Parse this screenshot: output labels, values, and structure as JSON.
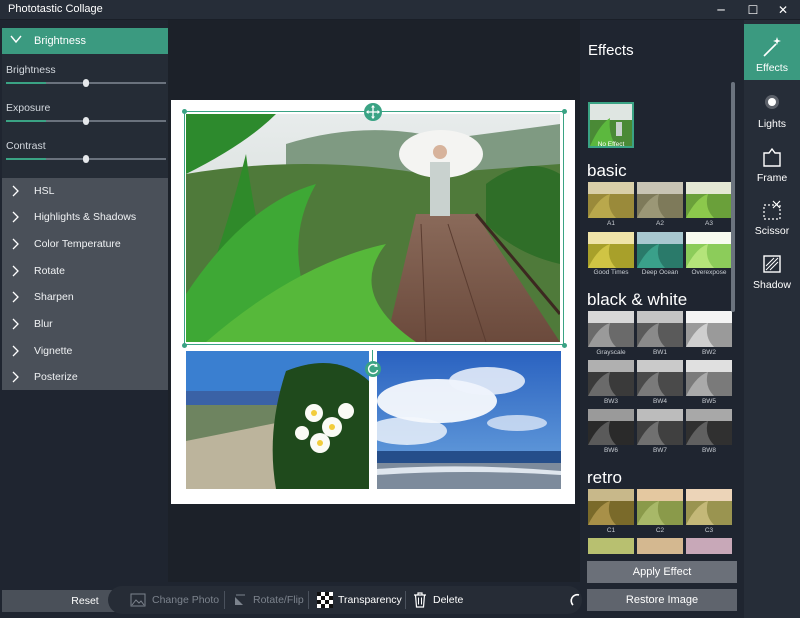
{
  "window": {
    "title": "Phototastic Collage",
    "minimize_glyph": "─",
    "maximize_glyph": "☐",
    "close_glyph": "✕"
  },
  "adjustments": {
    "header": "Brightness",
    "sliders": [
      {
        "label": "Brightness",
        "value": 0.5
      },
      {
        "label": "Exposure",
        "value": 0.5
      },
      {
        "label": "Contrast",
        "value": 0.5
      }
    ],
    "categories": [
      "HSL",
      "Highlights & Shadows",
      "Color Temperature",
      "Rotate",
      "Sharpen",
      "Blur",
      "Vignette",
      "Posterize"
    ]
  },
  "effects": {
    "title": "Effects",
    "no_effect": "No Effect",
    "sections": [
      {
        "title": "basic",
        "items": [
          "A1",
          "A2",
          "A3",
          "Good Times",
          "Deep Ocean",
          "Overexpose"
        ]
      },
      {
        "title": "black & white",
        "items": [
          "Grayscale",
          "BW1",
          "BW2",
          "BW3",
          "BW4",
          "BW5",
          "BW6",
          "BW7",
          "BW8"
        ]
      },
      {
        "title": "retro",
        "items": [
          "C1",
          "C2",
          "C3"
        ]
      }
    ],
    "apply_label": "Apply Effect",
    "restore_label": "Restore Image"
  },
  "tools": [
    {
      "label": "Effects",
      "icon": "magic-wand-icon",
      "active": true
    },
    {
      "label": "Lights",
      "icon": "light-icon",
      "active": false
    },
    {
      "label": "Frame",
      "icon": "frame-icon",
      "active": false
    },
    {
      "label": "Scissor",
      "icon": "scissor-icon",
      "active": false
    },
    {
      "label": "Shadow",
      "icon": "shadow-icon",
      "active": false
    }
  ],
  "bottom": {
    "reset": "Reset",
    "change_photo": "Change Photo",
    "rotate_flip": "Rotate/Flip",
    "transparency": "Transparency",
    "delete": "Delete"
  },
  "colors": {
    "accent": "#3b9a80",
    "panel": "#252c36",
    "background": "#1f2530"
  }
}
